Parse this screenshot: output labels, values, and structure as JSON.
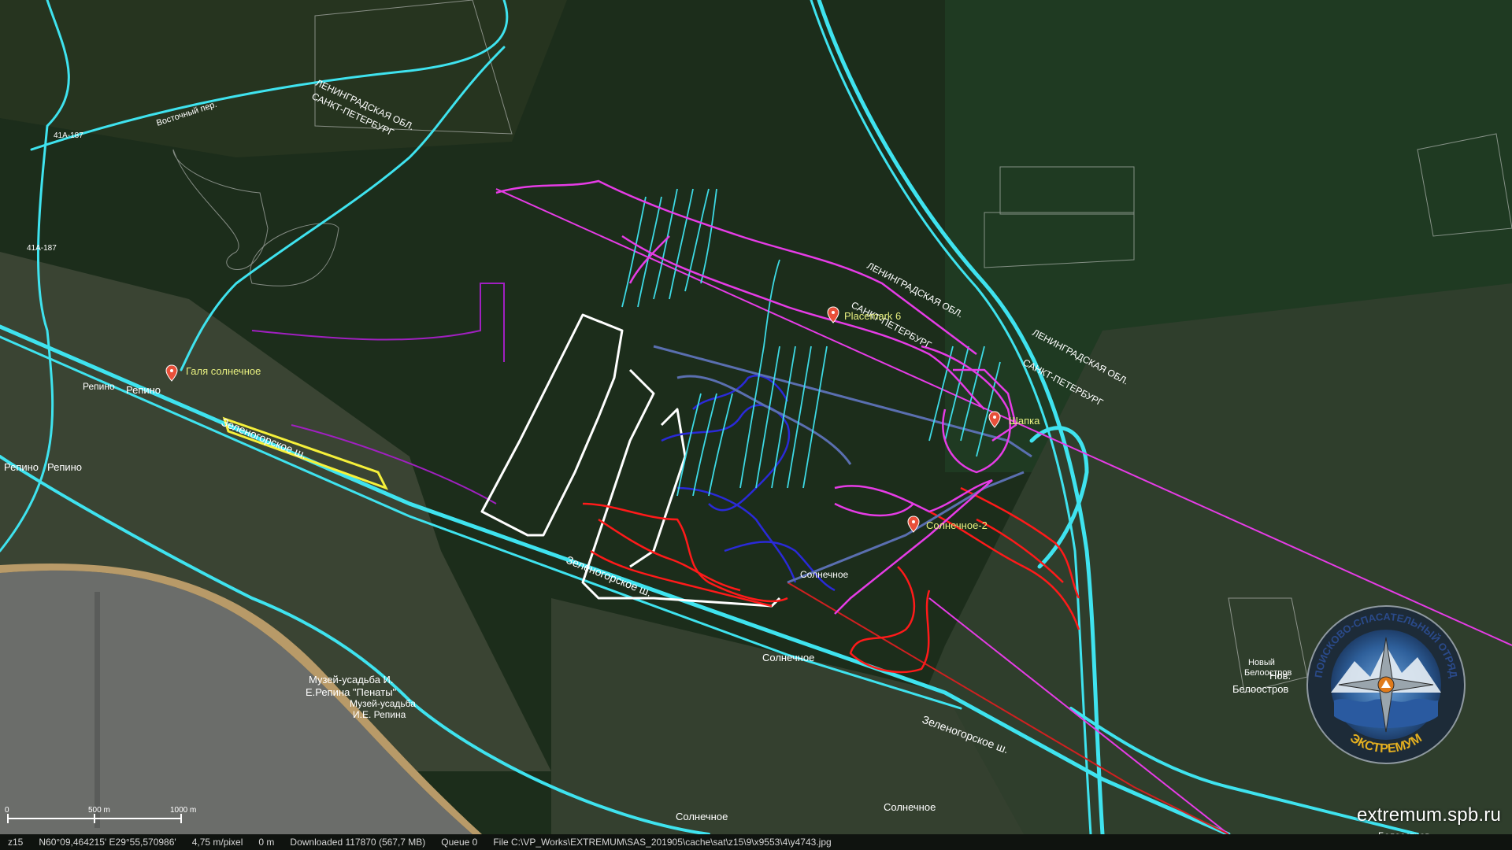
{
  "map": {
    "labels": {
      "oblast1": "ЛЕНИНГРАДСКАЯ ОБЛ.",
      "spb1": "САНКТ-ПЕТЕРБУРГ",
      "oblast2": "ЛЕНИНГРАДСКАЯ ОБЛ.",
      "spb2": "САНКТ-ПЕТЕРБУРГ",
      "oblast3": "ЛЕНИНГРАДСКАЯ ОБЛ.",
      "spb3": "САНКТ-ПЕТЕРБУРГ",
      "road_zel1": "Зеленогорское ш.",
      "road_zel2": "Зеленогорское ш.",
      "road_zel3": "Зеленогорское ш.",
      "road_vost": "Восточный пер.",
      "road_a1": "41А-187",
      "road_a2": "41А-187",
      "repino": "Репино",
      "repino2": "Репино",
      "repino3": "Репино",
      "repino4": "Репино",
      "museum1": "Музей-усадьба И.",
      "museum2": "Е.Репина \"Пенаты\"",
      "museum3": "Музей-усадьба",
      "museum4": "И.Е. Репина",
      "solnechnoe1": "Солнечное",
      "solnechnoe2": "Солнечное",
      "solnechnoe3": "Солнечное",
      "solnechnoe4": "Солнечное",
      "novy": "Новый",
      "beloostrov": "Белоостров",
      "nov_bel1": "Нов.",
      "nov_bel2": "Белоостров",
      "beloostrov_bottom": "Белоостров"
    },
    "placemarks": [
      {
        "name": "Галя солнечное"
      },
      {
        "name": "Placemark 6"
      },
      {
        "name": "Шапка"
      },
      {
        "name": "Солнечное-2"
      }
    ],
    "scale": {
      "label_0": "0",
      "label_500": "500 m",
      "label_1000": "1000 m"
    },
    "logo": {
      "top_text": "ПОИСКОВО-СПАСАТЕЛЬНЫЙ ОТРЯД",
      "bottom_text": "ЭКСТРЕМУМ"
    },
    "watermark": "extremum.spb.ru",
    "colors": {
      "road_cyan": "#3fe3ef",
      "track_magenta": "#e63ce6",
      "track_purple": "#a020c0",
      "track_red": "#ff1a1a",
      "track_blue": "#2a2ad8",
      "track_white": "#ffffff",
      "track_yellow": "#f5f03a",
      "forest": "#1f3320",
      "water": "#6a6a6a"
    }
  },
  "statusbar": {
    "zoom": "z15",
    "coords": "N60°09,464215' E29°55,570986'",
    "resolution": "4,75 m/pixel",
    "altitude": "0 m",
    "downloaded": "Downloaded 117870 (567,7 MB)",
    "queue": "Queue 0",
    "file": "File C:\\VP_Works\\EXTREMUM\\SAS_201905\\cache\\sat\\z15\\9\\x9553\\4\\y4743.jpg"
  }
}
